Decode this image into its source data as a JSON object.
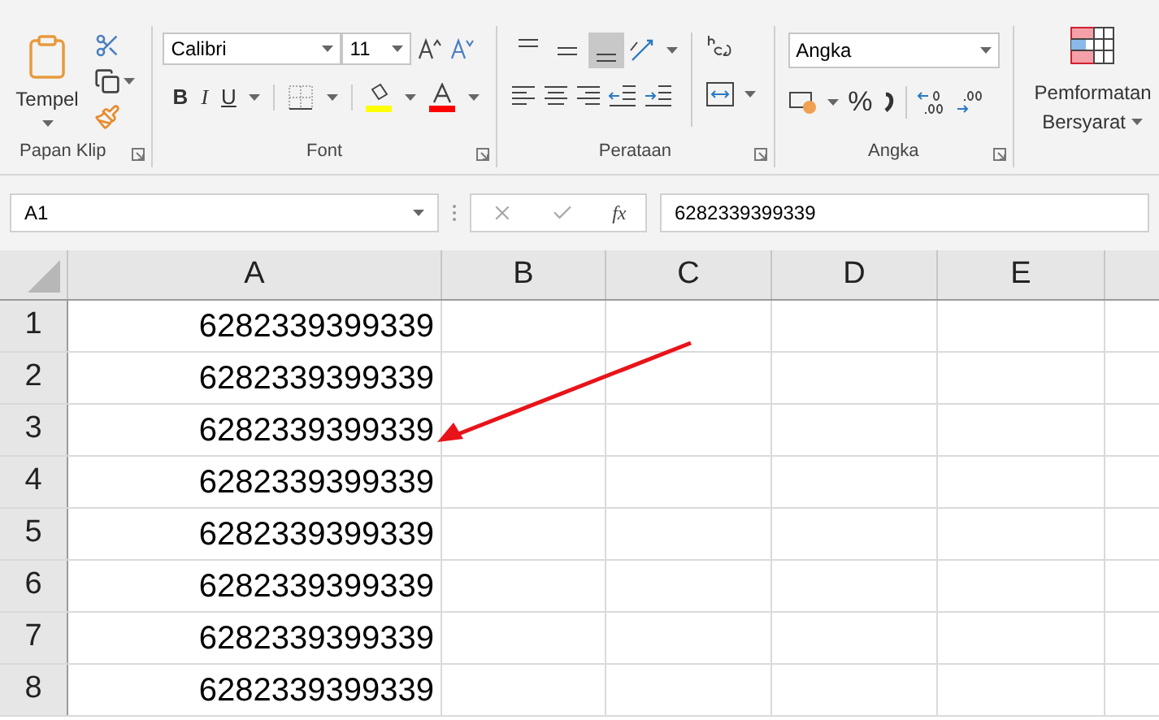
{
  "ribbon": {
    "clipboard": {
      "paste": "Tempel",
      "label": "Papan Klip"
    },
    "font": {
      "name": "Calibri",
      "size": "11",
      "bold": "B",
      "italic": "I",
      "underline": "U",
      "label": "Font"
    },
    "alignment": {
      "vertical": [
        {
          "selected": false
        },
        {
          "selected": false
        },
        {
          "selected": true
        }
      ],
      "label": "Perataan"
    },
    "number": {
      "format": "Angka",
      "percent": "%",
      "label": "Angka"
    },
    "styles": {
      "conditional_formatting": [
        "Pemformatan",
        "Bersyarat"
      ]
    }
  },
  "formula_bar": {
    "name_box": "A1",
    "fx": "fx",
    "value": "6282339399339"
  },
  "sheet": {
    "columns": [
      "A",
      "B",
      "C",
      "D",
      "E"
    ],
    "rows": [
      {
        "number": "1",
        "a": "6282339399339"
      },
      {
        "number": "2",
        "a": "6282339399339"
      },
      {
        "number": "3",
        "a": "6282339399339"
      },
      {
        "number": "4",
        "a": "6282339399339"
      },
      {
        "number": "5",
        "a": "6282339399339"
      },
      {
        "number": "6",
        "a": "6282339399339"
      },
      {
        "number": "7",
        "a": "6282339399339"
      },
      {
        "number": "8",
        "a": "6282339399339"
      }
    ]
  }
}
